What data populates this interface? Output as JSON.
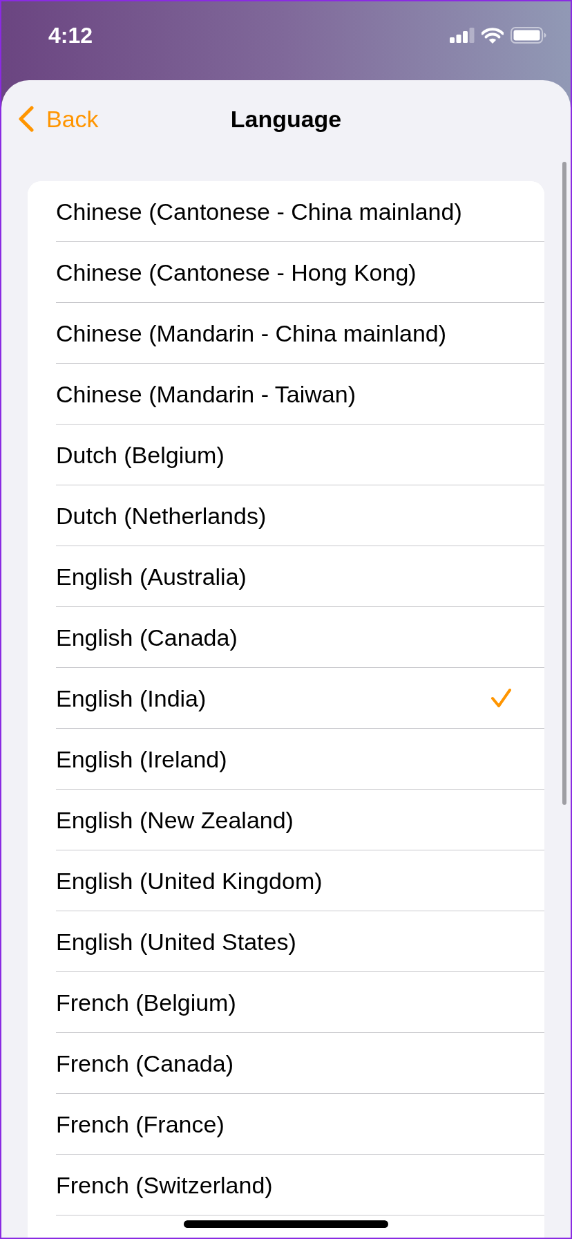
{
  "status_bar": {
    "time": "4:12"
  },
  "nav_bar": {
    "back_label": "Back",
    "title": "Language"
  },
  "languages": [
    {
      "label": "Chinese (Cantonese - China mainland)",
      "selected": false
    },
    {
      "label": "Chinese (Cantonese - Hong Kong)",
      "selected": false
    },
    {
      "label": "Chinese (Mandarin - China mainland)",
      "selected": false
    },
    {
      "label": "Chinese (Mandarin - Taiwan)",
      "selected": false
    },
    {
      "label": "Dutch (Belgium)",
      "selected": false
    },
    {
      "label": "Dutch (Netherlands)",
      "selected": false
    },
    {
      "label": "English (Australia)",
      "selected": false
    },
    {
      "label": "English (Canada)",
      "selected": false
    },
    {
      "label": "English (India)",
      "selected": true
    },
    {
      "label": "English (Ireland)",
      "selected": false
    },
    {
      "label": "English (New Zealand)",
      "selected": false
    },
    {
      "label": "English (United Kingdom)",
      "selected": false
    },
    {
      "label": "English (United States)",
      "selected": false
    },
    {
      "label": "French (Belgium)",
      "selected": false
    },
    {
      "label": "French (Canada)",
      "selected": false
    },
    {
      "label": "French (France)",
      "selected": false
    },
    {
      "label": "French (Switzerland)",
      "selected": false
    }
  ]
}
